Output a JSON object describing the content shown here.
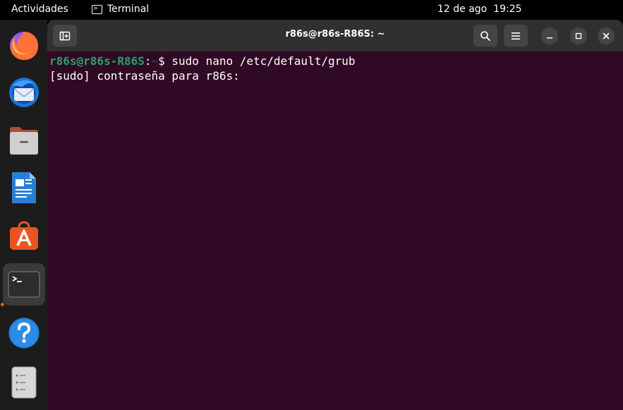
{
  "topbar": {
    "activities": "Actividades",
    "app_name": "Terminal",
    "date": "12 de ago",
    "time": "19:25"
  },
  "dock": {
    "items": [
      {
        "name": "firefox",
        "icon": "firefox-icon"
      },
      {
        "name": "thunderbird",
        "icon": "thunderbird-icon"
      },
      {
        "name": "files",
        "icon": "files-icon"
      },
      {
        "name": "libreoffice-writer",
        "icon": "writer-icon"
      },
      {
        "name": "app-center",
        "icon": "app-center-icon"
      },
      {
        "name": "terminal",
        "icon": "terminal-icon",
        "active": true
      },
      {
        "name": "help",
        "icon": "help-icon"
      },
      {
        "name": "trash",
        "icon": "trash-icon"
      }
    ]
  },
  "window": {
    "title": "r86s@r86s-R86S: ~",
    "lines": [
      {
        "user": "r86s@r86s-R86S",
        "sep": ":",
        "path": "~",
        "dollar": "$ ",
        "command": "sudo nano /etc/default/grub"
      },
      {
        "text": "[sudo] contraseña para r86s: "
      }
    ]
  },
  "colors": {
    "terminal_bg": "#300a24",
    "prompt_user": "#26a269",
    "prompt_path": "#12488b",
    "accent": "#e95420"
  }
}
